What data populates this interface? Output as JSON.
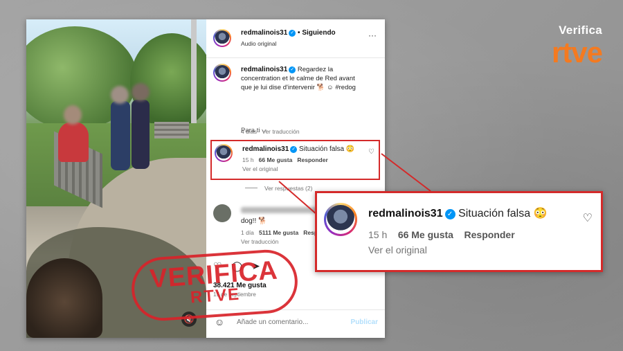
{
  "brand": {
    "top": "Verifica",
    "bottom": "rtve",
    "accent": "#f47a20"
  },
  "watermark": {
    "line1": "VERIFICA",
    "line2": "RTVE",
    "color": "#d8232a"
  },
  "post": {
    "username": "redmalinois31",
    "follow_status": "• Siguiendo",
    "audio": "Audio original",
    "more_icon": "more-icon",
    "caption": "Regardez la concentration et le calme de Red avant que je lui dise d'intervenir 🐕 ☺ #redog",
    "caption_age": "4 días",
    "translate": "Ver traducción",
    "for_you": "Para ti ⌵"
  },
  "highlight_comment": {
    "username": "redmalinois31",
    "text": "Situación falsa 😳",
    "age": "15 h",
    "likes": "66 Me gusta",
    "reply": "Responder",
    "original": "Ver el original",
    "border_color": "#d42a2a"
  },
  "replies": {
    "label": "Ver respuestas (2)"
  },
  "comment2": {
    "text": "dog!! 🐕",
    "age": "1 día",
    "likes": "5111 Me gusta",
    "reply": "Resp",
    "translate": "Ver traducción"
  },
  "footer": {
    "likes": "38.421 Me gusta",
    "date": "15 de septiembre",
    "placeholder": "Añade un comentario...",
    "publish": "Publicar"
  }
}
